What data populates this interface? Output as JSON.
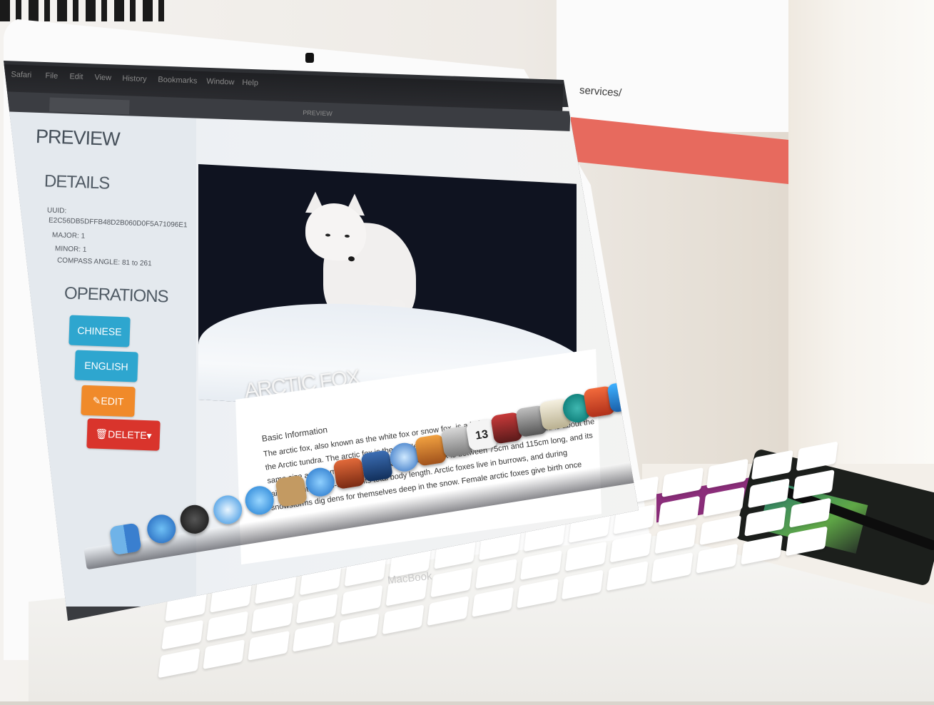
{
  "menubar": {
    "items": [
      "Safari",
      "File",
      "Edit",
      "View",
      "History",
      "Bookmarks",
      "Window",
      "Help"
    ]
  },
  "tabs": {
    "active": "PREVIEW"
  },
  "page": {
    "title": "PREVIEW",
    "details": {
      "heading": "DETAILS",
      "uuid_label": "UUID:",
      "uuid_value": "E2C56DB5DFFB48D2B060D0F5A71096E1",
      "major": "MAJOR: 1",
      "minor": "MINOR: 1",
      "compass": "COMPASS ANGLE: 81 to 261"
    },
    "operations": {
      "heading": "OPERATIONS",
      "chinese": "CHINESE",
      "english": "ENGLISH",
      "edit": "EDIT",
      "delete": "DELETE"
    },
    "hero": {
      "caption": "ARCTIC FOX"
    },
    "content": {
      "heading": "Basic Information",
      "body": "The arctic fox, also known as the white fox or snow fox, is a hairy mammal commonly found in the Arctic tundra. The arctic fox is the smallest canine animal native to Canada, and is about the same size as a domestic cat. Generally, an arctic fox is between 75cm and 115cm long, and its tail accounts for 30-35% of its total body length. Arctic foxes live in burrows, and during snowstorms dig dens for themselves deep in the snow. Female arctic foxes give birth once"
    }
  },
  "dock": {
    "calendar_day": "13"
  },
  "laptop": {
    "brand": "MacBook"
  },
  "background": {
    "banner_text": "services/"
  },
  "colors": {
    "btn_blue": "#2ea6cf",
    "btn_orange": "#f08a2a",
    "btn_red": "#d9342c",
    "banner_red": "#e76a5e"
  },
  "icons": [
    "finder-icon",
    "app-store-icon",
    "dashboard-icon",
    "safari-icon",
    "facetime-icon",
    "contacts-icon",
    "itunes-icon",
    "photo-booth-icon",
    "imovie-icon",
    "dvd-player-icon",
    "garageband-icon",
    "iphoto-icon",
    "calendar-icon",
    "photo-icon",
    "image-capture-icon",
    "preview-icon",
    "arduino-icon",
    "app-icon",
    "cube-icon",
    "trash-icon"
  ]
}
